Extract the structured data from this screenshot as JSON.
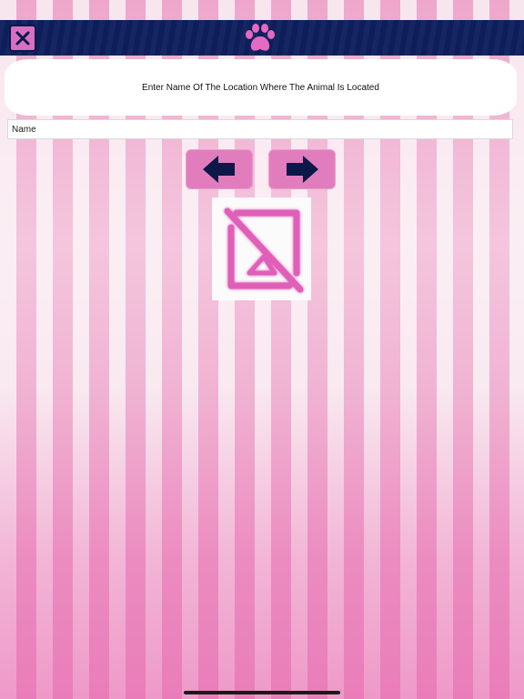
{
  "navbar": {
    "close_icon": "close-x-icon",
    "logo_icon": "paw-icon",
    "bar_color": "#0f1f5e",
    "button_color": "#d76fc2"
  },
  "prompt": {
    "text": "Enter Name Of The Location Where The Animal Is Located"
  },
  "name_field": {
    "placeholder": "Name",
    "value": ""
  },
  "navigation": {
    "prev_icon": "arrow-left-icon",
    "next_icon": "arrow-right-icon",
    "button_color": "#e27dbd",
    "arrow_color": "#0b1848"
  },
  "image": {
    "icon": "broken-image-icon"
  },
  "theme": {
    "stripe_light": "#f8e6ee",
    "stripe_pink": "#eea7cb",
    "accent_pink": "#e05fb8"
  }
}
